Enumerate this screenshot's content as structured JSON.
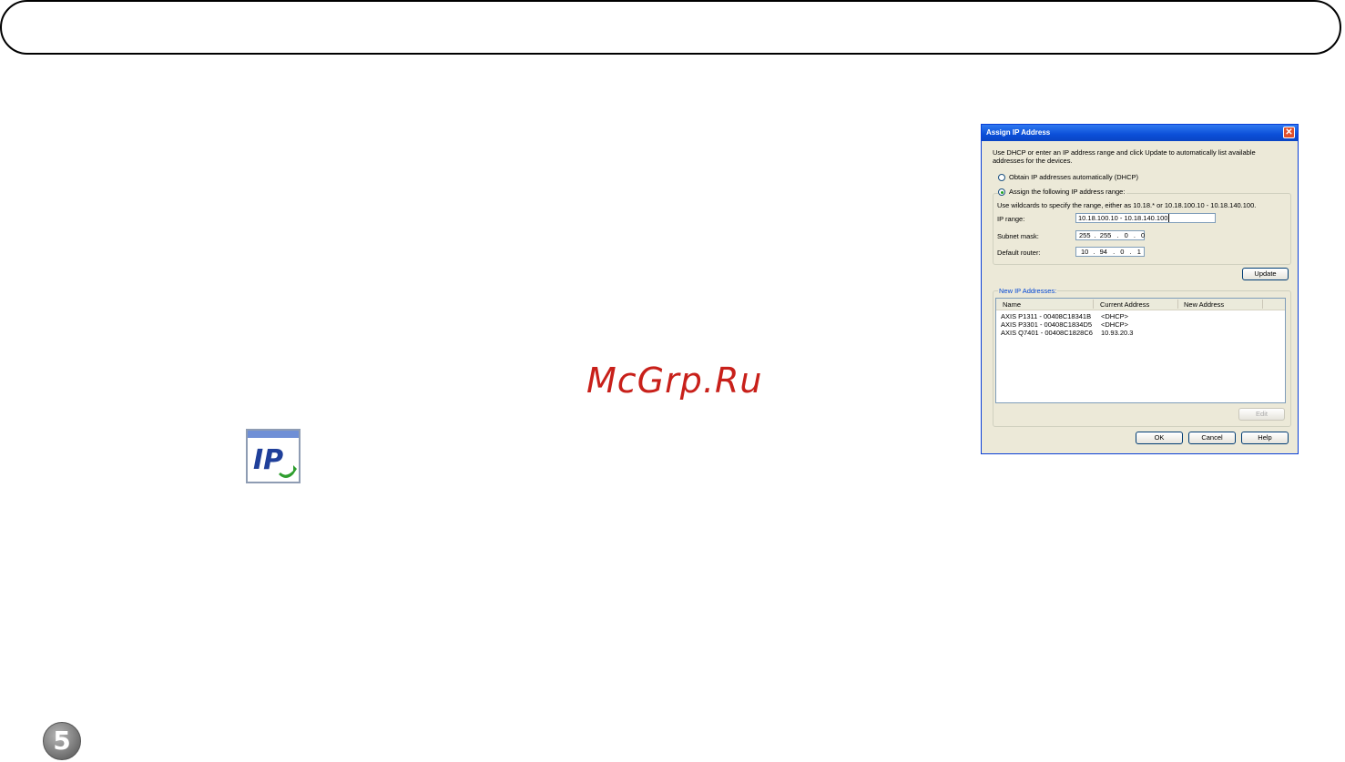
{
  "watermark": "McGrp.Ru",
  "page_number": "5",
  "icon_ip_text": "IP",
  "dialog": {
    "title": "Assign IP Address",
    "close_glyph": "✕",
    "intro": "Use DHCP or enter an IP address range and click Update to automatically list available addresses for the devices.",
    "radio_dhcp_label": "Obtain IP addresses automatically (DHCP)",
    "radio_range_label": "Assign the following IP address range:",
    "range_hint": "Use wildcards to specify the range, either as 10.18.* or 10.18.100.10 - 10.18.140.100.",
    "ip_range_label": "IP range:",
    "ip_range_value": "10.18.100.10 - 10.18.140.100",
    "subnet_label": "Subnet mask:",
    "subnet": [
      "255",
      "255",
      "0",
      "0"
    ],
    "router_label": "Default router:",
    "router": [
      "10",
      "94",
      "0",
      "1"
    ],
    "update_label": "Update",
    "new_ip_label": "New IP Addresses:",
    "columns": [
      "Name",
      "Current Address",
      "New Address"
    ],
    "rows": [
      {
        "name": "AXIS P1311 - 00408C18341B",
        "current": "<DHCP>",
        "new": ""
      },
      {
        "name": "AXIS P3301 - 00408C1834D5",
        "current": "<DHCP>",
        "new": ""
      },
      {
        "name": "AXIS Q7401 - 00408C1828C6",
        "current": "10.93.20.3",
        "new": ""
      }
    ],
    "edit_label": "Edit",
    "ok_label": "OK",
    "cancel_label": "Cancel",
    "help_label": "Help"
  }
}
